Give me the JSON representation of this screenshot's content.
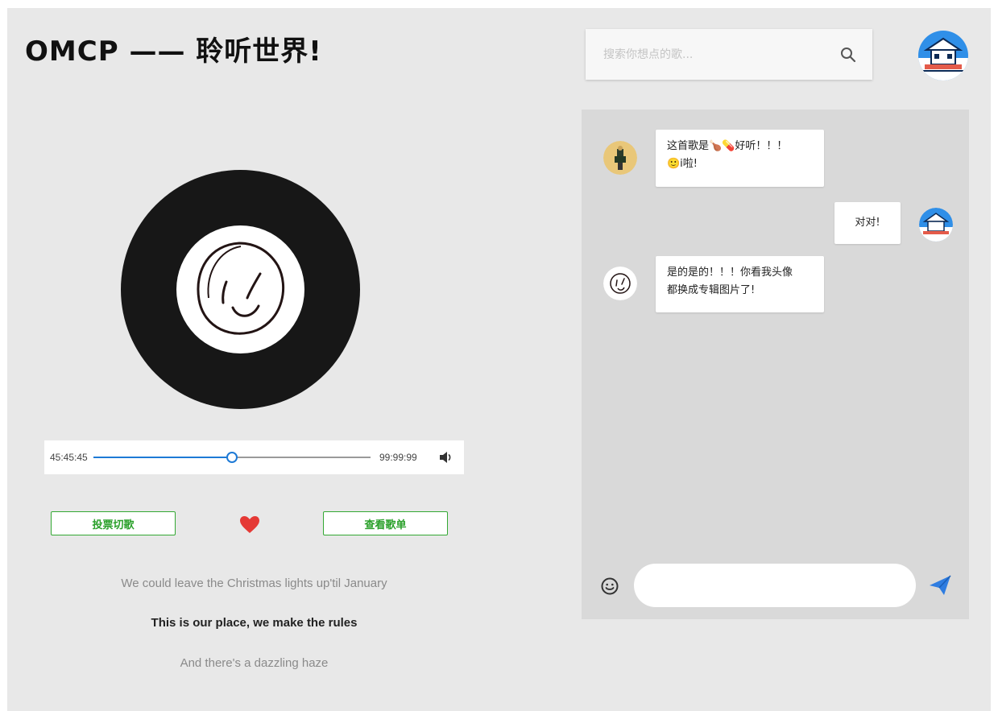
{
  "header": {
    "title": "OMCP —— 聆听世界!"
  },
  "player": {
    "current_time": "45:45:45",
    "total_time": "99:99:99",
    "progress": 0.5,
    "accent_color": "#1e7ad6",
    "volume_icon": "volume-icon"
  },
  "actions": {
    "vote_label": "投票切歌",
    "playlist_label": "查看歌单",
    "like_icon": "heart-icon",
    "like_color": "#e53935",
    "button_color": "#2aa02a"
  },
  "lyrics": {
    "prev": "We could leave the Christmas lights up'til January",
    "current": "This is our place, we make the rules",
    "next": "And there's a dazzling haze"
  },
  "search": {
    "placeholder": "搜索你想点的歌...",
    "icon": "search-icon"
  },
  "chat": {
    "messages": [
      {
        "side": "left",
        "line1": "这首歌是🍗💊好听！！！",
        "line2": "🙂i啦!"
      },
      {
        "side": "right",
        "line1": "对对!"
      },
      {
        "side": "left",
        "line1": "是的是的！！！你看我头像",
        "line2": "都换成专辑图片了!"
      }
    ],
    "emoji_icon": "smile-icon",
    "send_icon": "send-icon",
    "send_color": "#2f7de1"
  }
}
